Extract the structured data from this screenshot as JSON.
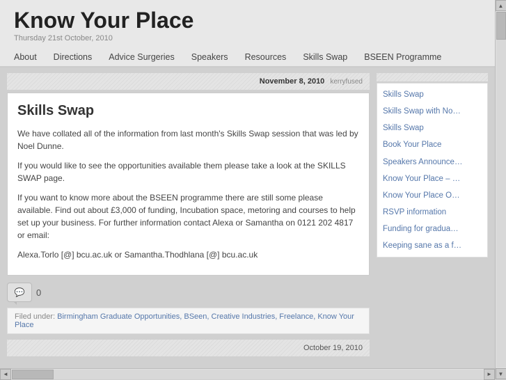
{
  "site": {
    "title": "Know Your Place",
    "subtitle": "Thursday 21st October, 2010"
  },
  "nav": {
    "items": [
      {
        "label": "About",
        "name": "about"
      },
      {
        "label": "Directions",
        "name": "directions"
      },
      {
        "label": "Advice Surgeries",
        "name": "advice-surgeries"
      },
      {
        "label": "Speakers",
        "name": "speakers"
      },
      {
        "label": "Resources",
        "name": "resources"
      },
      {
        "label": "Skills Swap",
        "name": "skills-swap"
      },
      {
        "label": "BSEEN Programme",
        "name": "bseen-programme"
      }
    ]
  },
  "post": {
    "date": "November 8, 2010",
    "author": "kerryfused",
    "title": "Skills Swap",
    "body": [
      "We have collated all of the information from last month's Skills Swap session that was led by Noel Dunne.",
      "If you would like to see the opportunities available them please take a look at the SKILLS SWAP page.",
      "If you want to know more about the BSEEN programme there are still some please available. Find out about £3,000 of funding, Incubation space, metoring and courses to help set up your business. For further information contact Alexa or Samantha on 0121 202 4817 or email:",
      "Alexa.Torlo [@] bcu.ac.uk or Samantha.Thodhlana [@] bcu.ac.uk"
    ],
    "comment_count": "0",
    "filed_label": "Filed under:",
    "categories": "Birmingham Graduate Opportunities, BSeen, Creative Industries, Freelance, Know Your Place"
  },
  "next_post": {
    "date": "October 19, 2010"
  },
  "sidebar": {
    "links": [
      {
        "label": "Skills Swap"
      },
      {
        "label": "Skills Swap with No…"
      },
      {
        "label": "Skills Swap"
      },
      {
        "label": "Book Your Place"
      },
      {
        "label": "Speakers Announce…"
      },
      {
        "label": "Know Your Place – …"
      },
      {
        "label": "Know Your Place O…"
      },
      {
        "label": "RSVP information"
      },
      {
        "label": "Funding for gradua…"
      },
      {
        "label": "Keeping sane as a f…"
      }
    ]
  },
  "scrollbar": {
    "up": "▲",
    "down": "▼",
    "left": "◄",
    "right": "►"
  }
}
